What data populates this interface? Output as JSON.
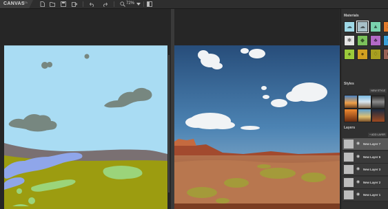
{
  "app": {
    "name": "CANVAS",
    "badge": "BETA"
  },
  "toolbar": {
    "icons": [
      "new-file-icon",
      "open-file-icon",
      "save-icon",
      "export-icon",
      "undo-icon",
      "redo-icon",
      "zoom-icon",
      "dropdown-icon",
      "split-view-icon"
    ],
    "zoom_label": "72%"
  },
  "panel": {
    "materials_title": "Materials",
    "materials": [
      {
        "icon": "cloud",
        "color": "#9fd8e6"
      },
      {
        "icon": "cloud-selected",
        "color": "#a8c0c8"
      },
      {
        "icon": "mountain",
        "color": "#7ad3ae"
      },
      {
        "icon": "flame",
        "color": "#e07a2c"
      },
      {
        "icon": "snowflake",
        "color": "#e5e5e5"
      },
      {
        "icon": "hill",
        "color": "#7bc15b"
      },
      {
        "icon": "plant",
        "color": "#b46ac6"
      },
      {
        "icon": "water",
        "color": "#3aa0d8"
      },
      {
        "icon": "tree",
        "color": "#9ccc3b"
      },
      {
        "icon": "rock",
        "color": "#d2a020"
      },
      {
        "icon": "grass",
        "color": "#a8a020"
      },
      {
        "icon": "dirt",
        "color": "#9a6256"
      }
    ],
    "styles_title": "Styles",
    "new_style_label": "NEW STYLE",
    "layers_title": "Layers",
    "add_layer_label": "+ ADD LAYER",
    "layers": [
      {
        "name": "New Layer 7",
        "active": true
      },
      {
        "name": "New Layer 6",
        "active": false
      },
      {
        "name": "New Layer 3",
        "active": false
      },
      {
        "name": "New Layer 2",
        "active": false
      },
      {
        "name": "New Layer 1",
        "active": false
      }
    ]
  }
}
